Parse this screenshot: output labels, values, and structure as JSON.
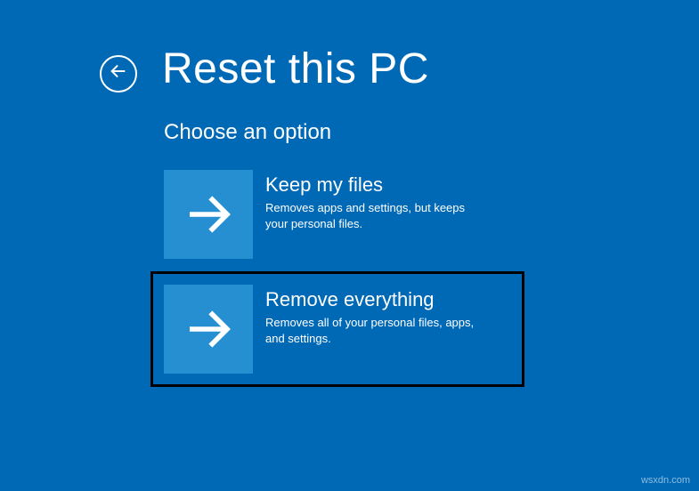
{
  "header": {
    "title": "Reset this PC"
  },
  "subtitle": "Choose an option",
  "options": [
    {
      "title": "Keep my files",
      "description": "Removes apps and settings, but keeps your personal files."
    },
    {
      "title": "Remove everything",
      "description": "Removes all of your personal files, apps, and settings."
    }
  ],
  "watermark": "wsxdn.com"
}
